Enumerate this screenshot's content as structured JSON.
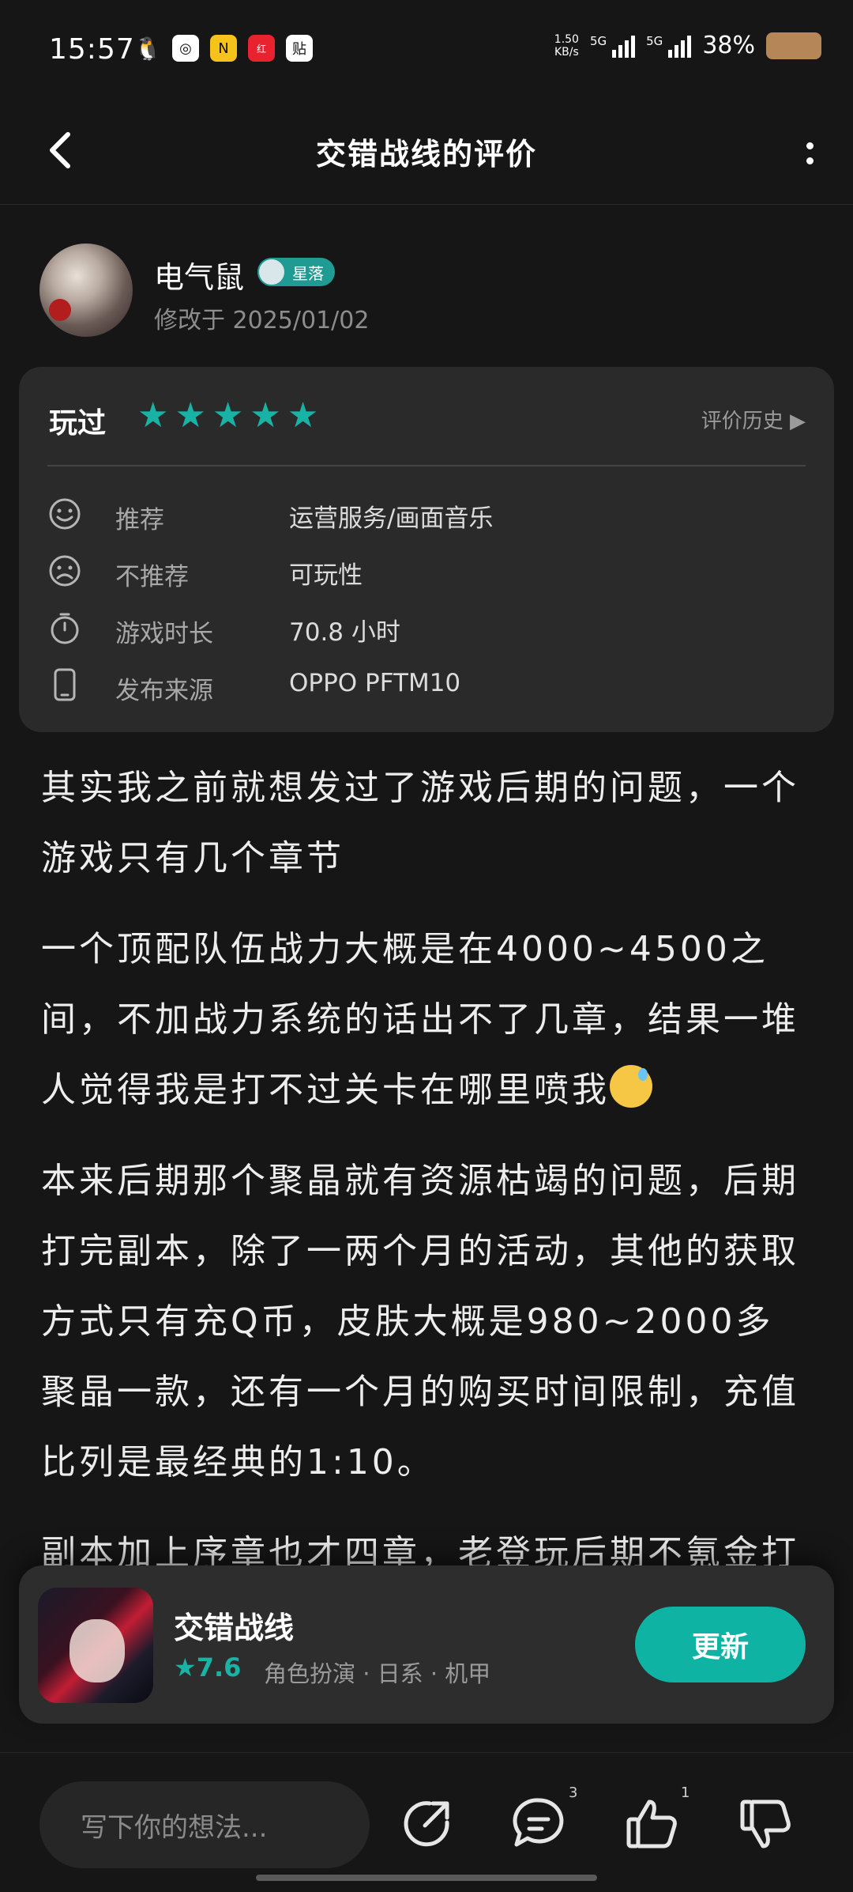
{
  "status": {
    "time": "15:57",
    "net_speed_value": "1.50",
    "net_speed_unit": "KB/s",
    "signal1": "5G",
    "signal2": "5G",
    "battery": "38%",
    "app_icons": [
      "qq-icon",
      "chat-app-icon",
      "n-app-icon",
      "xiaohongshu-icon",
      "tieba-icon"
    ]
  },
  "nav": {
    "title": "交错战线的评价"
  },
  "author": {
    "name": "电气鼠",
    "badge": "星落",
    "modified": "修改于 2025/01/02"
  },
  "rating": {
    "status": "玩过",
    "stars": 5,
    "history_label": "评价历史",
    "rows": [
      {
        "icon": "smile-icon",
        "label": "推荐",
        "value": "运营服务/画面音乐"
      },
      {
        "icon": "frown-icon",
        "label": "不推荐",
        "value": "可玩性"
      },
      {
        "icon": "stopwatch-icon",
        "label": "游戏时长",
        "value": "70.8 小时"
      },
      {
        "icon": "phone-icon",
        "label": "发布来源",
        "value": "OPPO PFTM10"
      }
    ]
  },
  "review": {
    "p1": "其实我之前就想发过了游戏后期的问题，一个游戏只有几个章节",
    "p2": "一个顶配队伍战力大概是在4000~4500之间，不加战力系统的话出不了几章，结果一堆人觉得我是打不过关卡在哪里喷我",
    "p3": "本来后期那个聚晶就有资源枯竭的问题，后期打完副本，除了一两个月的活动，其他的获取方式只有充Q币，皮肤大概是980~2000多聚晶一款，还有一个月的购买时间限制，充值比列是最经典的1:10。",
    "p4": "副本加上序章也才四章，老登玩后期不氪金打"
  },
  "game": {
    "name": "交错战线",
    "score": "7.6",
    "tags": "角色扮演 · 日系 · 机甲",
    "button": "更新"
  },
  "bottom": {
    "placeholder": "写下你的想法...",
    "comment_count": "3",
    "like_count": "1"
  },
  "colors": {
    "accent": "#19b3a5",
    "background": "#161616",
    "card": "#2a2a2a"
  }
}
